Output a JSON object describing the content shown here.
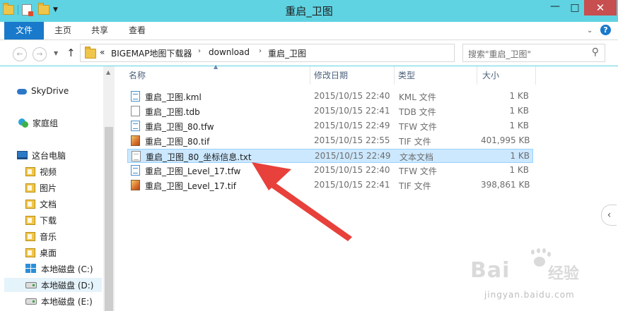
{
  "window": {
    "title": "重启_卫图",
    "controls": {
      "minimize": "—",
      "maximize": "□",
      "close": "✕"
    }
  },
  "ribbon": {
    "tabs": [
      "文件",
      "主页",
      "共享",
      "查看"
    ],
    "help": "?"
  },
  "address": {
    "overflow": "«",
    "crumbs": [
      "BIGEMAP地图下载器",
      "download",
      "重启_卫图"
    ],
    "search_placeholder": "搜索\"重启_卫图\""
  },
  "nav": {
    "skydrive": "SkyDrive",
    "homegroup": "家庭组",
    "this_pc": "这台电脑",
    "libraries": [
      "视频",
      "图片",
      "文档",
      "下载",
      "音乐",
      "桌面"
    ],
    "drives": [
      "本地磁盘 (C:)",
      "本地磁盘 (D:)",
      "本地磁盘 (E:)"
    ]
  },
  "columns": {
    "name": "名称",
    "date": "修改日期",
    "type": "类型",
    "size": "大小"
  },
  "files": [
    {
      "name": "重启_卫图.kml",
      "date": "2015/10/15 22:40",
      "type": "KML 文件",
      "size": "1 KB",
      "icon": "kml-file-icon"
    },
    {
      "name": "重启_卫图.tdb",
      "date": "2015/10/15 22:41",
      "type": "TDB 文件",
      "size": "1 KB",
      "icon": "tdb-file-icon"
    },
    {
      "name": "重启_卫图_80.tfw",
      "date": "2015/10/15 22:49",
      "type": "TFW 文件",
      "size": "1 KB",
      "icon": "tfw-file-icon"
    },
    {
      "name": "重启_卫图_80.tif",
      "date": "2015/10/15 22:55",
      "type": "TIF 文件",
      "size": "401,995 KB",
      "icon": "tif-file-icon"
    },
    {
      "name": "重启_卫图_80_坐标信息.txt",
      "date": "2015/10/15 22:49",
      "type": "文本文档",
      "size": "1 KB",
      "icon": "txt-file-icon",
      "selected": true
    },
    {
      "name": "重启_卫图_Level_17.tfw",
      "date": "2015/10/15 22:40",
      "type": "TFW 文件",
      "size": "1 KB",
      "icon": "tfw-file-icon"
    },
    {
      "name": "重启_卫图_Level_17.tif",
      "date": "2015/10/15 22:41",
      "type": "TIF 文件",
      "size": "398,861 KB",
      "icon": "tif-file-icon"
    }
  ],
  "watermark": {
    "logo": "Bai",
    "logo_cn": "经验",
    "url": "jingyan.baidu.com"
  },
  "colors": {
    "titlebar": "#5fd3e2",
    "file_tab": "#1979ca",
    "selection": "#cce8ff",
    "arrow": "#e8403a"
  }
}
